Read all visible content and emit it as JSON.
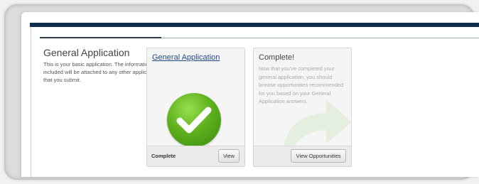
{
  "intro": {
    "title": "General Application",
    "description": "This is your basic application. The information included will be attached to any other application that you submit."
  },
  "application_card": {
    "link_label": "General Application",
    "status": "Complete",
    "view_button": "View",
    "check_color": "#5fb11d"
  },
  "complete_card": {
    "title": "Complete!",
    "message": "Now that you've completed your general application, you should browse opportunities recommended for you based on your General Application answers.",
    "button": "View Opportunities",
    "arrow_color": "#e4efe0"
  },
  "colors": {
    "header_bar": "#0f2d4f",
    "link": "#22488a"
  }
}
